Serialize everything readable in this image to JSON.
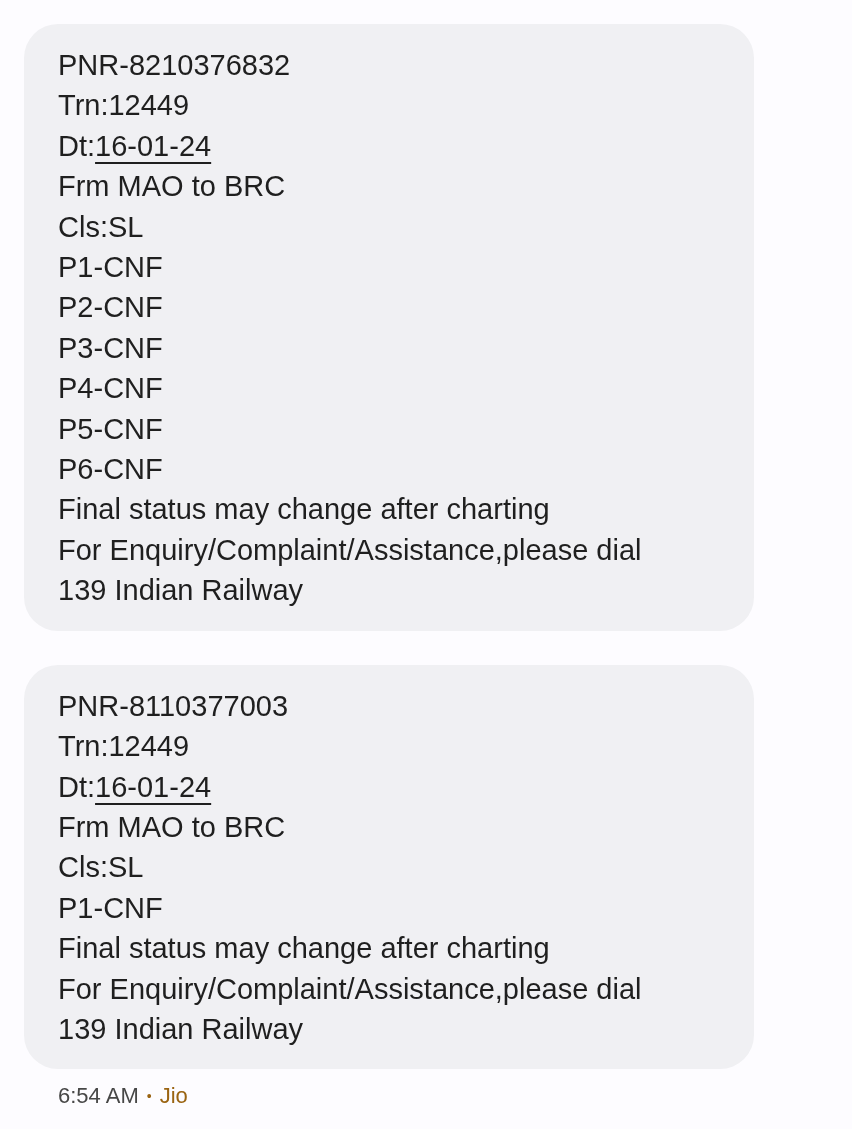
{
  "messages": [
    {
      "lines": [
        {
          "kind": "text",
          "text": "PNR-8210376832"
        },
        {
          "kind": "text",
          "text": "Trn:12449"
        },
        {
          "kind": "date",
          "prefix": "Dt:",
          "link": "16-01-24"
        },
        {
          "kind": "text",
          "text": "Frm MAO to BRC"
        },
        {
          "kind": "text",
          "text": "Cls:SL"
        },
        {
          "kind": "text",
          "text": "P1-CNF"
        },
        {
          "kind": "text",
          "text": "P2-CNF"
        },
        {
          "kind": "text",
          "text": "P3-CNF"
        },
        {
          "kind": "text",
          "text": "P4-CNF"
        },
        {
          "kind": "text",
          "text": "P5-CNF"
        },
        {
          "kind": "text",
          "text": "P6-CNF"
        },
        {
          "kind": "text",
          "text": "Final status may change after charting"
        },
        {
          "kind": "text",
          "text": "For Enquiry/Complaint/Assistance,please dial"
        },
        {
          "kind": "text",
          "text": "139 Indian Railway"
        }
      ]
    },
    {
      "lines": [
        {
          "kind": "text",
          "text": "PNR-8110377003"
        },
        {
          "kind": "text",
          "text": "Trn:12449"
        },
        {
          "kind": "date",
          "prefix": "Dt:",
          "link": "16-01-24"
        },
        {
          "kind": "text",
          "text": "Frm MAO to BRC"
        },
        {
          "kind": "text",
          "text": "Cls:SL"
        },
        {
          "kind": "text",
          "text": "P1-CNF"
        },
        {
          "kind": "text",
          "text": "Final status may change after charting"
        },
        {
          "kind": "text",
          "text": "For Enquiry/Complaint/Assistance,please dial"
        },
        {
          "kind": "text",
          "text": "139 Indian Railway"
        }
      ]
    }
  ],
  "footer": {
    "time": "6:54 AM",
    "separator": "•",
    "carrier": "Jio"
  }
}
